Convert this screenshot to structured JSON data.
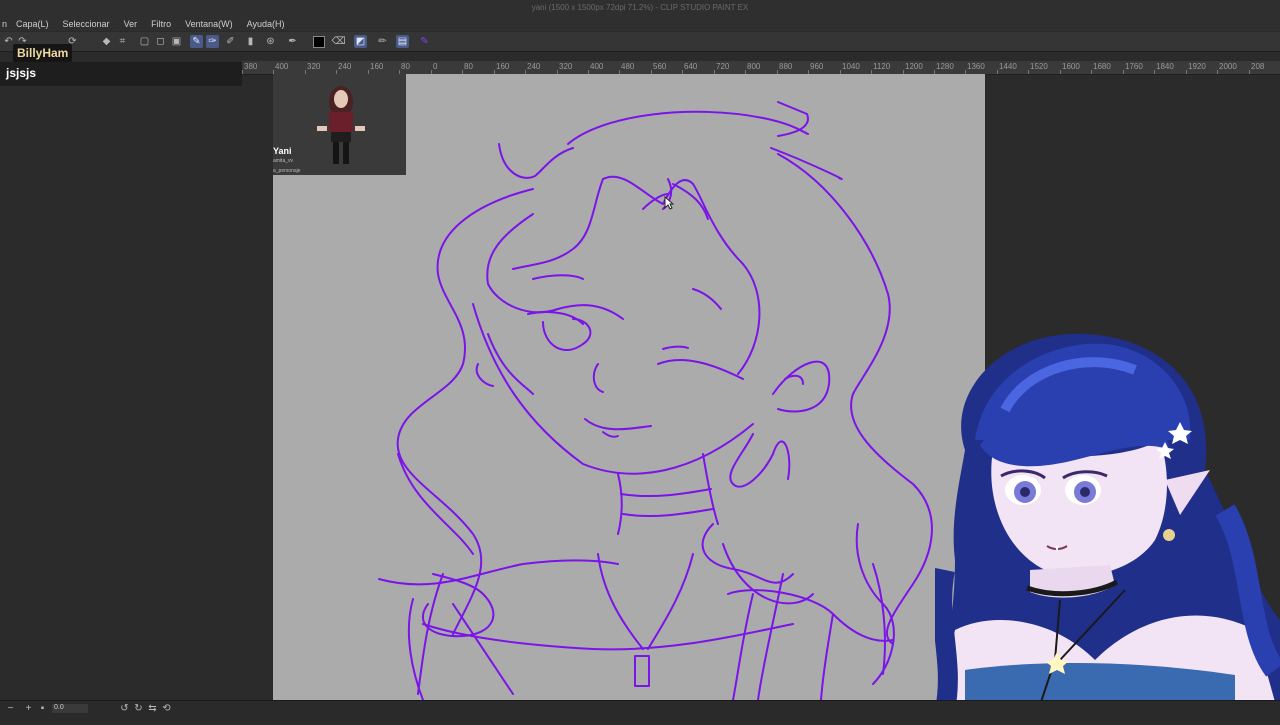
{
  "window": {
    "title": "yani (1500 x 1500px 72dpi 71.2%) - CLIP STUDIO PAINT EX"
  },
  "menu": [
    "Capa(L)",
    "Seleccionar",
    "Ver",
    "Filtro",
    "Ventana(W)",
    "Ayuda(H)"
  ],
  "menu_fragment": "n",
  "chat": {
    "username": "BillyHam",
    "message": "jsjsjs"
  },
  "reference": {
    "name": "Yani",
    "handle": "amita_vv",
    "caption": "a_personaje"
  },
  "ruler": {
    "labels": [
      "380",
      "400",
      "320",
      "240",
      "160",
      "80",
      "0",
      "80",
      "160",
      "240",
      "320",
      "400",
      "480",
      "560",
      "640",
      "720",
      "800",
      "880",
      "960",
      "1040",
      "1120",
      "1200",
      "1280",
      "1360",
      "1440",
      "1520",
      "1600",
      "1680",
      "1760",
      "1840",
      "1920",
      "2000",
      "208"
    ]
  },
  "status": {
    "zoom_value": "0.0"
  },
  "colors": {
    "stroke": "#7b14e8",
    "canvas": "#ababab",
    "accent": "#4a5a88"
  },
  "icons": [
    "brush-icon",
    "lasso-icon",
    "eraser-icon",
    "pen-icon",
    "fill-icon",
    "gradient-icon"
  ]
}
